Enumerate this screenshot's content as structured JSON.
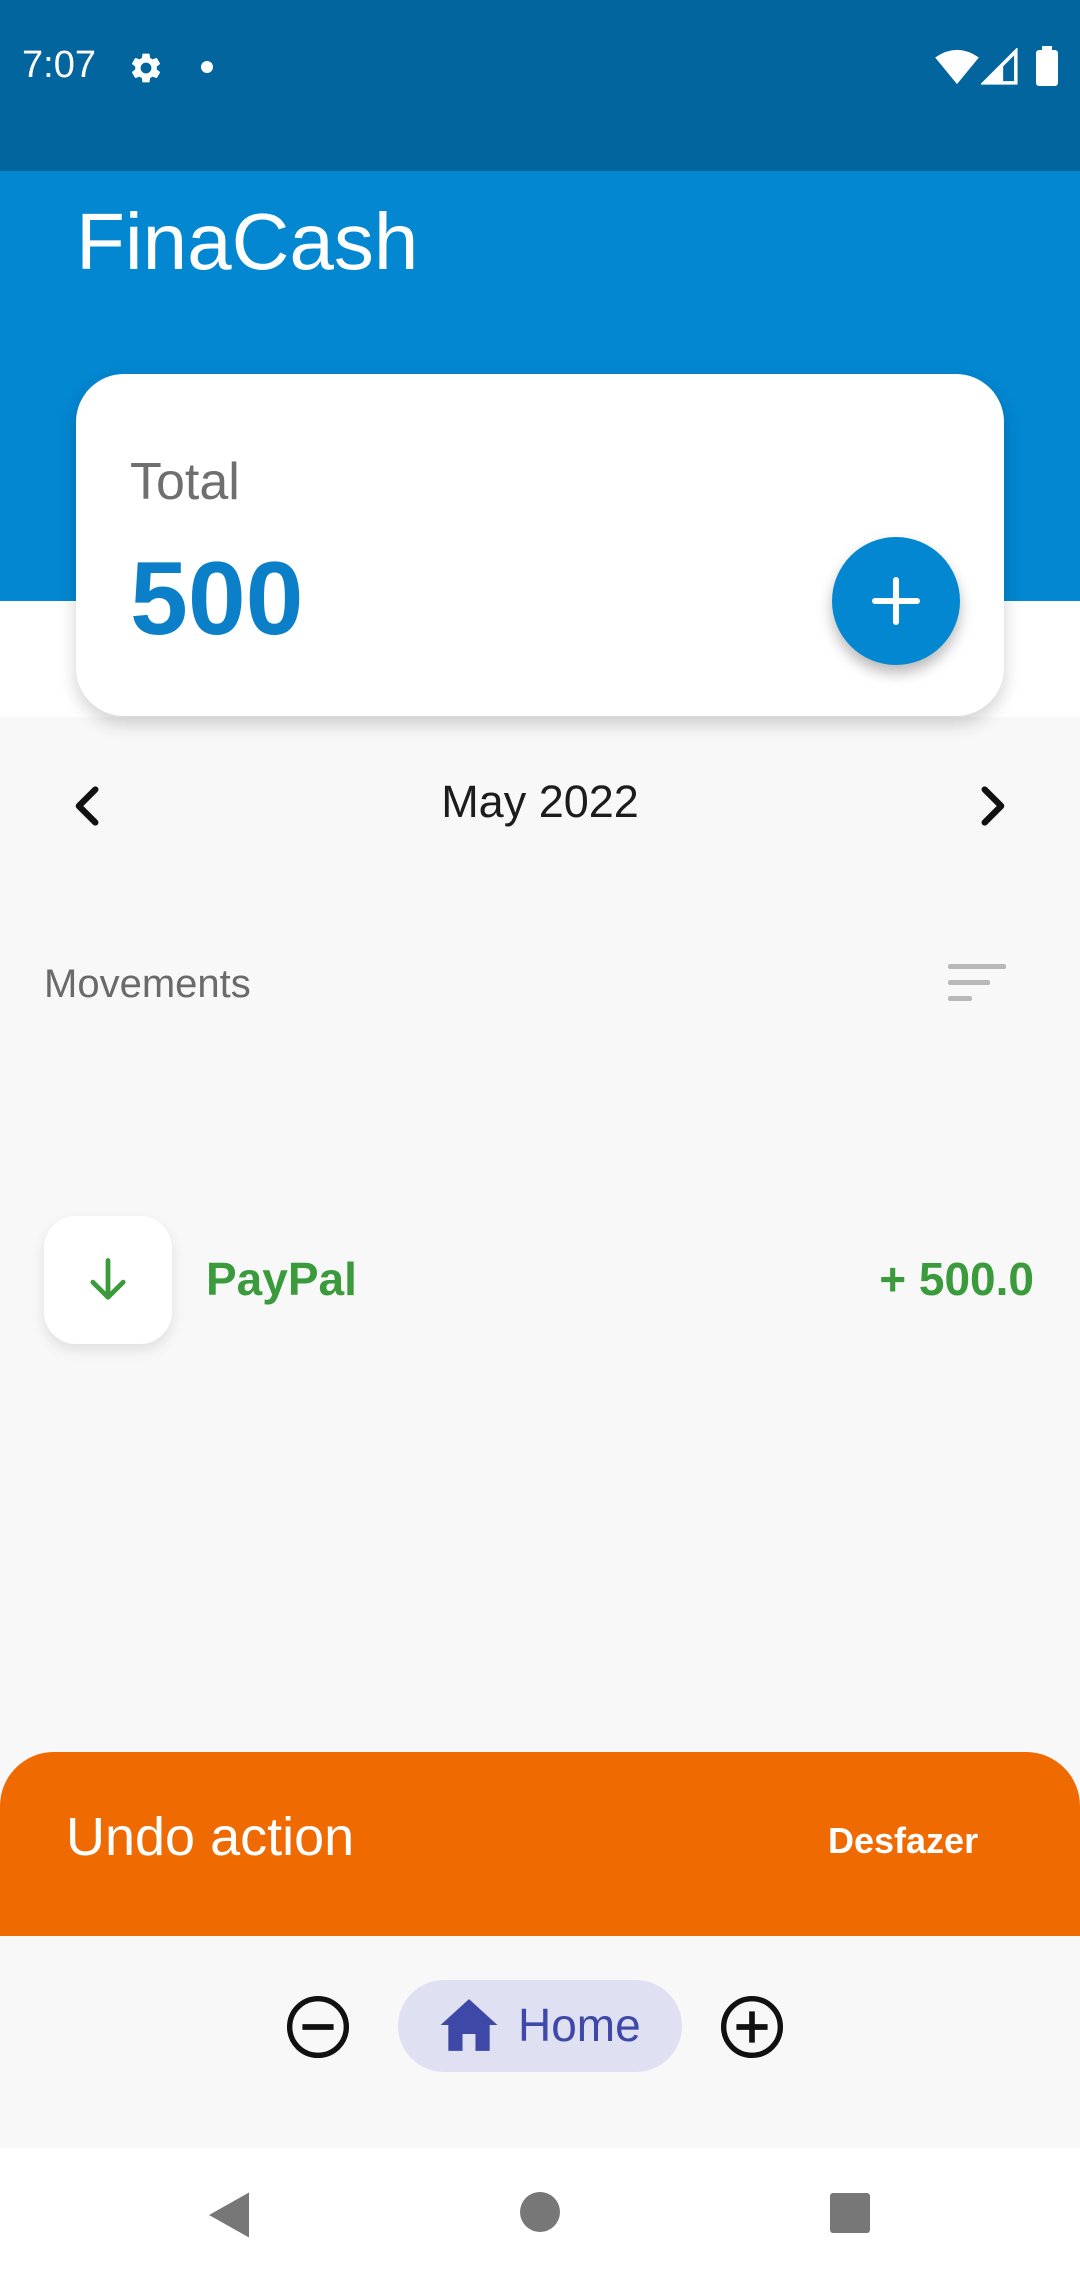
{
  "status_bar": {
    "time": "7:07"
  },
  "app": {
    "title": "FinaCash"
  },
  "summary": {
    "label": "Total",
    "value": "500"
  },
  "month": {
    "label": "May 2022"
  },
  "movements": {
    "header": "Movements",
    "items": [
      {
        "name": "PayPal",
        "amount": "+ 500.0",
        "direction": "income"
      }
    ]
  },
  "snackbar": {
    "message": "Undo action",
    "action": "Desfazer"
  },
  "bottom_nav": {
    "home_label": "Home"
  },
  "colors": {
    "status_bar": "#02659e",
    "primary": "#0387d1",
    "income": "#3b9a3c",
    "snackbar": "#ef6a00",
    "nav_active_bg": "#dfe1f3",
    "nav_active_fg": "#3e48a6"
  },
  "icons": [
    "gear-icon",
    "wifi-icon",
    "signal-icon",
    "battery-icon",
    "plus-icon",
    "chevron-left-icon",
    "chevron-right-icon",
    "sort-icon",
    "arrow-down-icon",
    "minus-circle-icon",
    "home-icon",
    "plus-circle-icon",
    "back-icon",
    "home-circle-icon",
    "recents-icon"
  ]
}
